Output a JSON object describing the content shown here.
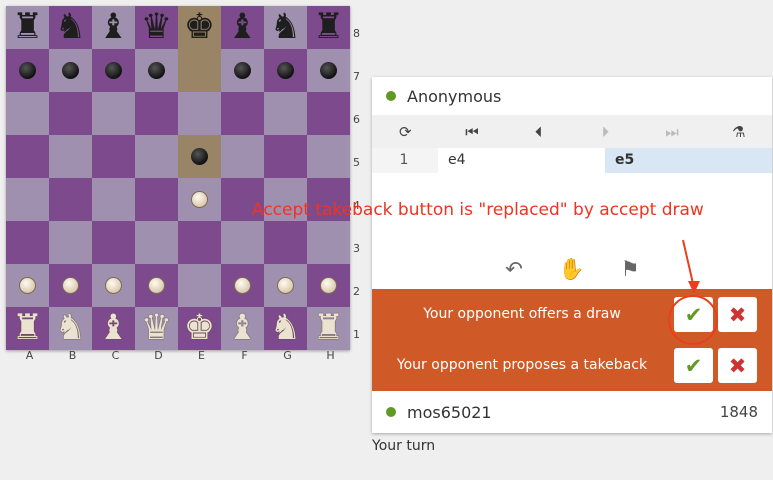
{
  "board": {
    "rows": [
      [
        "l:br",
        "d:bn",
        "l:bb",
        "d:bq",
        "hl:bk",
        "d:bb",
        "l:bn",
        "d:br"
      ],
      [
        "d:bp",
        "l:bp",
        "d:bp",
        "l:bp",
        "hl:",
        "l:bp",
        "d:bp",
        "l:bp"
      ],
      [
        "l:",
        "d:",
        "l:",
        "d:",
        "l:",
        "d:",
        "l:",
        "d:"
      ],
      [
        "d:",
        "l:",
        "d:",
        "l:",
        "hl:bp",
        "l:",
        "d:",
        "l:"
      ],
      [
        "l:",
        "d:",
        "l:",
        "d:",
        "l:wp",
        "d:",
        "l:",
        "d:"
      ],
      [
        "d:",
        "l:",
        "d:",
        "l:",
        "d:",
        "l:",
        "d:",
        "l:"
      ],
      [
        "l:wp",
        "d:wp",
        "l:wp",
        "d:wp",
        "l:",
        "d:wp",
        "l:wp",
        "d:wp"
      ],
      [
        "d:wr",
        "l:wn",
        "d:wb",
        "l:wq",
        "d:wk",
        "l:wb",
        "d:wn",
        "l:wr"
      ]
    ],
    "ranks": [
      "8",
      "7",
      "6",
      "5",
      "4",
      "3",
      "2",
      "1"
    ],
    "files": [
      "A",
      "B",
      "C",
      "D",
      "E",
      "F",
      "G",
      "H"
    ]
  },
  "opponent": {
    "name": "Anonymous"
  },
  "player": {
    "name": "mos65021",
    "rating": "1848"
  },
  "moves": {
    "number": "1",
    "white": "e4",
    "black": "e5"
  },
  "offers": {
    "draw_text": "Your opponent offers a draw",
    "takeback_text": "Your opponent proposes a takeback",
    "accept_symbol": "✔",
    "decline_symbol": "✖"
  },
  "status": "Your turn",
  "annotation": "Accept takeback button is \"replaced\" by accept draw",
  "colors": {
    "accent": "#629924",
    "offer_bg": "#cf5a27",
    "annotation": "#ee3420"
  }
}
